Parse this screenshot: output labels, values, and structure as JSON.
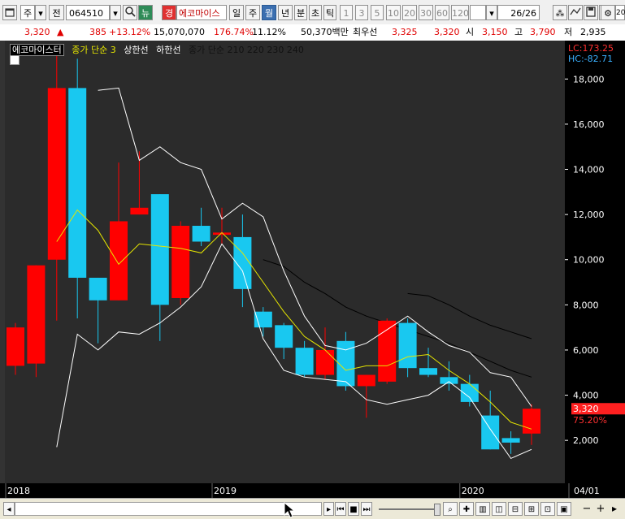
{
  "toolbar": {
    "menu_icon": "window-menu-icon",
    "type_label": "주",
    "prefix_label": "전",
    "stock_code": "064510",
    "search_icon": "search-icon",
    "news_label": "뉴",
    "kyung_label": "경",
    "stock_name": "에코마이스",
    "periods": [
      "일",
      "주",
      "월",
      "년"
    ],
    "selected_period": "월",
    "intervals": [
      "분",
      "초",
      "틱"
    ],
    "numbers": [
      "1",
      "3",
      "5",
      "10",
      "20",
      "30",
      "60",
      "120"
    ],
    "page_counter": "26/26",
    "right_icons": [
      "settings-icon",
      "chart-type-icon",
      "save-icon",
      "layout-icon",
      "gear-icon"
    ],
    "right_number": "20"
  },
  "pricebar": {
    "price": "3,320",
    "arrow": "▲",
    "change": "385",
    "change_pct": "+13.12%",
    "volume": "15,070,070",
    "volume_ratio": "176.74%",
    "turnover": "11.12%",
    "amount": "50,370백만",
    "pref_label": "최우선",
    "ask": "3,325",
    "bid": "3,320",
    "open_label": "시",
    "open": "3,150",
    "high_label": "고",
    "high": "3,790",
    "low_label": "저",
    "low": "2,935"
  },
  "legend": {
    "stock_name": "에코마이스터",
    "ma_label": "종가 단순 3",
    "upper_label": "상한선",
    "lower_label": "하한선",
    "ma_group_label": "종가 단순 210  220  230  240"
  },
  "indicators": {
    "lc": "LC:173.25",
    "hc": "HC:-82.71",
    "current_price": "3,320",
    "current_pct": "75.20%"
  },
  "colors": {
    "up": "#ff0000",
    "down": "#19c8f0",
    "ma": "#e6e600",
    "band": "#ffffff",
    "long_ma": "#000000",
    "background": "#2b2b2b"
  },
  "chart_data": {
    "type": "candlestick",
    "y_ticks": [
      2000,
      4000,
      6000,
      8000,
      10000,
      12000,
      14000,
      16000,
      18000
    ],
    "y_tick_labels": [
      "2,000",
      "4,000",
      "6,000",
      "8,000",
      "10,000",
      "12,000",
      "14,000",
      "16,000",
      "18,000"
    ],
    "ylim": [
      100,
      19700
    ],
    "x_labels": [
      "2018",
      "2019",
      "2020",
      "04/01"
    ],
    "x_label_slots": [
      0,
      10,
      22
    ],
    "candles": [
      {
        "o": 5300,
        "c": 7000,
        "h": 7200,
        "l": 4900
      },
      {
        "o": 5400,
        "c": 9750,
        "h": 9750,
        "l": 4800
      },
      {
        "o": 10000,
        "c": 17600,
        "h": 19200,
        "l": 7300
      },
      {
        "o": 17600,
        "c": 9200,
        "h": 18900,
        "l": 7400
      },
      {
        "o": 9200,
        "c": 8200,
        "h": 9200,
        "l": 6300
      },
      {
        "o": 8200,
        "c": 11700,
        "h": 14300,
        "l": 8200
      },
      {
        "o": 12000,
        "c": 12300,
        "h": 14800,
        "l": 12000
      },
      {
        "o": 12900,
        "c": 8000,
        "h": 12900,
        "l": 6400
      },
      {
        "o": 8300,
        "c": 11500,
        "h": 11700,
        "l": 8000
      },
      {
        "o": 11500,
        "c": 10800,
        "h": 12300,
        "l": 10600
      },
      {
        "o": 11100,
        "c": 11200,
        "h": 12300,
        "l": 10700
      },
      {
        "o": 11000,
        "c": 8700,
        "h": 12000,
        "l": 7900
      },
      {
        "o": 7700,
        "c": 7000,
        "h": 7900,
        "l": 6600
      },
      {
        "o": 7100,
        "c": 6100,
        "h": 7200,
        "l": 5600
      },
      {
        "o": 6100,
        "c": 4900,
        "h": 6400,
        "l": 4800
      },
      {
        "o": 4900,
        "c": 6000,
        "h": 7000,
        "l": 4700
      },
      {
        "o": 6400,
        "c": 4400,
        "h": 6800,
        "l": 4200
      },
      {
        "o": 4400,
        "c": 4900,
        "h": 4900,
        "l": 3000
      },
      {
        "o": 4600,
        "c": 7300,
        "h": 7400,
        "l": 4500
      },
      {
        "o": 7200,
        "c": 5200,
        "h": 7400,
        "l": 4800
      },
      {
        "o": 5200,
        "c": 4900,
        "h": 6100,
        "l": 4800
      },
      {
        "o": 4800,
        "c": 4500,
        "h": 5500,
        "l": 4200
      },
      {
        "o": 4500,
        "c": 3700,
        "h": 4900,
        "l": 3500
      },
      {
        "o": 3100,
        "c": 1600,
        "h": 4200,
        "l": 1600
      },
      {
        "o": 2100,
        "c": 1900,
        "h": 2400,
        "l": 1400
      },
      {
        "o": 2300,
        "c": 3400,
        "h": 3600,
        "l": 1800
      }
    ],
    "series": [
      {
        "values": [
          null,
          null,
          10800,
          12200,
          11300,
          9800,
          10700,
          10600,
          10500,
          10300,
          11200,
          10300,
          9000,
          7700,
          6600,
          6000,
          5100,
          5300,
          5300,
          5700,
          5800,
          5100,
          4500,
          3700,
          2800,
          2500
        ]
      },
      {
        "values": [
          null,
          null,
          null,
          null,
          17500,
          17600,
          14400,
          15000,
          14300,
          14000,
          11800,
          12500,
          11900,
          9500,
          7500,
          6200,
          6000,
          6300,
          6900,
          7500,
          6800,
          6200,
          5900,
          5000,
          4800,
          3500
        ]
      },
      {
        "values": [
          null,
          null,
          1700,
          6700,
          6000,
          6800,
          6700,
          7200,
          7900,
          8800,
          10700,
          9500,
          6500,
          5100,
          4800,
          4700,
          4600,
          3800,
          3600,
          3800,
          4000,
          4600,
          3900,
          2500,
          1200,
          1600
        ]
      },
      {
        "values": [
          null,
          null,
          null,
          null,
          null,
          null,
          null,
          null,
          null,
          null,
          null,
          null,
          10000,
          9700,
          9000,
          8500,
          7900,
          7500,
          7200,
          6900,
          6600,
          6300,
          5900,
          5500,
          5100,
          4800
        ]
      },
      {
        "values": [
          null,
          null,
          null,
          null,
          null,
          null,
          null,
          null,
          null,
          null,
          null,
          null,
          null,
          null,
          null,
          null,
          null,
          null,
          null,
          8500,
          8400,
          8000,
          7500,
          7100,
          6800,
          6500
        ]
      }
    ]
  },
  "scrollbar": {
    "left_arrow": "◂",
    "controls": [
      "▸",
      "⏮",
      "■",
      "⏭"
    ],
    "zoom_minus": "−",
    "zoom_plus": "+",
    "icons": [
      "zoom-icon",
      "cross-icon",
      "chart-icon",
      "split-icon"
    ]
  }
}
